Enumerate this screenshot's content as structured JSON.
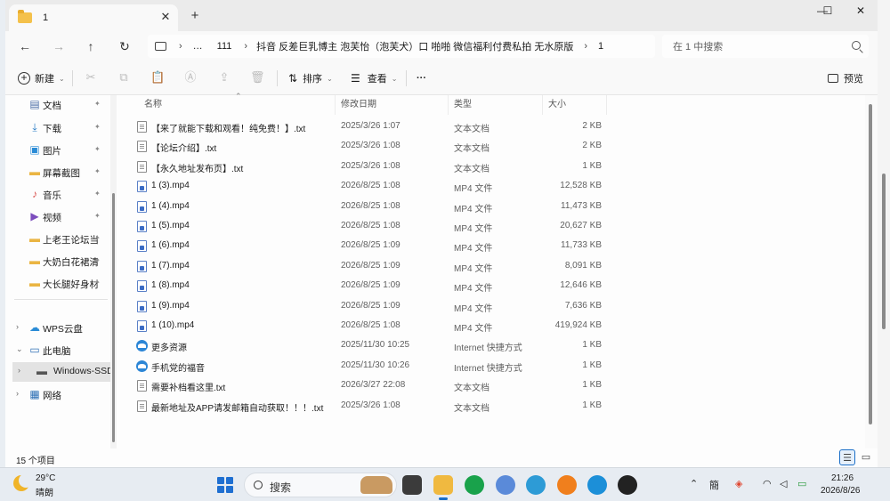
{
  "tab": {
    "title": "1",
    "close_icon": "✕",
    "new_tab_icon": "+"
  },
  "window_controls": {
    "minimize": "—",
    "maximize": "☐",
    "close": "✕"
  },
  "nav": {
    "back": "←",
    "forward": "→",
    "up": "↑",
    "refresh": "↻"
  },
  "address": {
    "overflow": "…",
    "sep": "›",
    "crumbs": [
      "111",
      "抖音 反差巨乳博主 泡芙怡（泡芙犬）口 啪啪 微信福利付费私拍 无水原版",
      "1"
    ]
  },
  "search": {
    "placeholder": "在 1 中搜索"
  },
  "toolbar": {
    "new_label": "新建",
    "sort_label": "排序",
    "view_label": "查看",
    "more_label": "···",
    "preview_label": "预览",
    "dropdown_arrow": "⌄"
  },
  "sidebar": {
    "quick_access": [
      {
        "label": "文档",
        "icon": "document-icon"
      },
      {
        "label": "下载",
        "icon": "download-icon"
      },
      {
        "label": "图片",
        "icon": "picture-icon"
      },
      {
        "label": "屏幕截图",
        "icon": "folder-icon"
      },
      {
        "label": "音乐",
        "icon": "music-icon"
      },
      {
        "label": "视频",
        "icon": "video-icon"
      },
      {
        "label": "上老王论坛当",
        "icon": "folder-icon"
      },
      {
        "label": "大奶白花裙清",
        "icon": "folder-icon"
      },
      {
        "label": "大长腿好身材",
        "icon": "folder-icon"
      }
    ],
    "pin": "📌",
    "tree": [
      {
        "label": "WPS云盘",
        "icon": "cloud-icon"
      },
      {
        "label": "此电脑",
        "icon": "computer-icon"
      },
      {
        "label": "Windows-SSD",
        "icon": "drive-icon"
      },
      {
        "label": "网络",
        "icon": "network-icon"
      }
    ]
  },
  "columns": {
    "name": "名称",
    "date": "修改日期",
    "type": "类型",
    "size": "大小"
  },
  "files": [
    {
      "name": "【来了就能下载和观看！纯免费！】.txt",
      "date": "2025/3/26 1:07",
      "type": "文本文档",
      "size": "2 KB",
      "kind": "txt"
    },
    {
      "name": "【论坛介绍】.txt",
      "date": "2025/3/26 1:08",
      "type": "文本文档",
      "size": "2 KB",
      "kind": "txt"
    },
    {
      "name": "【永久地址发布页】.txt",
      "date": "2025/3/26 1:08",
      "type": "文本文档",
      "size": "1 KB",
      "kind": "txt"
    },
    {
      "name": "1 (3).mp4",
      "date": "2026/8/25 1:08",
      "type": "MP4 文件",
      "size": "12,528 KB",
      "kind": "mp4"
    },
    {
      "name": "1 (4).mp4",
      "date": "2026/8/25 1:08",
      "type": "MP4 文件",
      "size": "11,473 KB",
      "kind": "mp4"
    },
    {
      "name": "1 (5).mp4",
      "date": "2026/8/25 1:08",
      "type": "MP4 文件",
      "size": "20,627 KB",
      "kind": "mp4"
    },
    {
      "name": "1 (6).mp4",
      "date": "2026/8/25 1:09",
      "type": "MP4 文件",
      "size": "11,733 KB",
      "kind": "mp4"
    },
    {
      "name": "1 (7).mp4",
      "date": "2026/8/25 1:09",
      "type": "MP4 文件",
      "size": "8,091 KB",
      "kind": "mp4"
    },
    {
      "name": "1 (8).mp4",
      "date": "2026/8/25 1:09",
      "type": "MP4 文件",
      "size": "12,646 KB",
      "kind": "mp4"
    },
    {
      "name": "1 (9).mp4",
      "date": "2026/8/25 1:09",
      "type": "MP4 文件",
      "size": "7,636 KB",
      "kind": "mp4"
    },
    {
      "name": "1 (10).mp4",
      "date": "2026/8/25 1:08",
      "type": "MP4 文件",
      "size": "419,924 KB",
      "kind": "mp4"
    },
    {
      "name": "更多资源",
      "date": "2025/11/30 10:25",
      "type": "Internet 快捷方式",
      "size": "1 KB",
      "kind": "url"
    },
    {
      "name": "手机党的福音",
      "date": "2025/11/30 10:26",
      "type": "Internet 快捷方式",
      "size": "1 KB",
      "kind": "url"
    },
    {
      "name": "需要补档看这里.txt",
      "date": "2026/3/27 22:08",
      "type": "文本文档",
      "size": "1 KB",
      "kind": "txt"
    },
    {
      "name": "最新地址及APP请发邮箱自动获取！！！.txt",
      "date": "2025/3/26 1:08",
      "type": "文本文档",
      "size": "1 KB",
      "kind": "txt"
    }
  ],
  "status": {
    "count": "15 个项目"
  },
  "taskbar": {
    "temp": "29°C",
    "weather": "晴朗",
    "search_label": "搜索",
    "time": "21:26",
    "date": "2026/8/26",
    "tray_ime": "簡"
  }
}
